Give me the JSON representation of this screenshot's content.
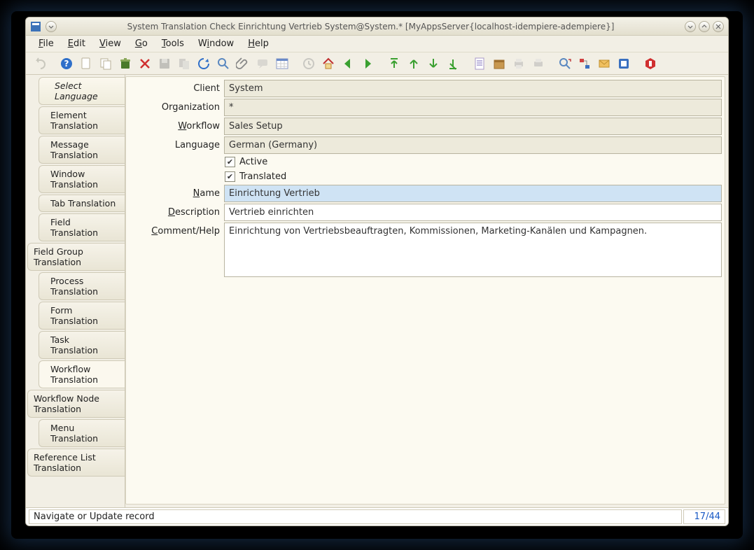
{
  "window": {
    "title": "System Translation Check  Einrichtung Vertrieb  System@System.* [MyAppsServer{localhost-idempiere-adempiere}]"
  },
  "menubar": {
    "file": "File",
    "edit": "Edit",
    "view": "View",
    "go": "Go",
    "tools": "Tools",
    "window": "Window",
    "help": "Help"
  },
  "sidebar": {
    "items": [
      {
        "label": "Select Language",
        "indent": 2,
        "selected": true
      },
      {
        "label": "Element Translation",
        "indent": 2
      },
      {
        "label": "Message Translation",
        "indent": 2
      },
      {
        "label": "Window Translation",
        "indent": 2
      },
      {
        "label": "Tab Translation",
        "indent": 2
      },
      {
        "label": "Field Translation",
        "indent": 2
      },
      {
        "label": "Field Group Translation",
        "indent": 0
      },
      {
        "label": "Process Translation",
        "indent": 2
      },
      {
        "label": "Form Translation",
        "indent": 2
      },
      {
        "label": "Task Translation",
        "indent": 2
      },
      {
        "label": "Workflow Translation",
        "indent": 2,
        "active": true
      },
      {
        "label": "Workflow Node Translation",
        "indent": 0
      },
      {
        "label": "Menu Translation",
        "indent": 2
      },
      {
        "label": "Reference List Translation",
        "indent": 0
      }
    ]
  },
  "form": {
    "labels": {
      "client": "Client",
      "organization": "Organization",
      "workflow": "Workflow",
      "language": "Language",
      "active": "Active",
      "translated": "Translated",
      "name": "Name",
      "description": "Description",
      "comment": "Comment/Help"
    },
    "values": {
      "client": "System",
      "organization": "*",
      "workflow": "Sales Setup",
      "language": "German (Germany)",
      "active": true,
      "translated": true,
      "name": "Einrichtung Vertrieb",
      "description": "Vertrieb einrichten",
      "comment": "Einrichtung von Vertriebsbeauftragten, Kommissionen, Marketing-Kanälen und Kampagnen."
    }
  },
  "statusbar": {
    "message": "Navigate or Update record",
    "position": "17/44"
  },
  "toolbar_icons": [
    "undo",
    "help",
    "new",
    "copy",
    "save",
    "delete-selection",
    "save-disabled",
    "copy-disabled",
    "refresh",
    "find",
    "attachment",
    "chat",
    "grid",
    "gear-disabled",
    "home",
    "prev",
    "next",
    "parent",
    "up",
    "down",
    "child",
    "report",
    "archive",
    "print-disabled",
    "print-preview-disabled",
    "zoom-across",
    "workflow",
    "requests",
    "product-info",
    "close"
  ]
}
